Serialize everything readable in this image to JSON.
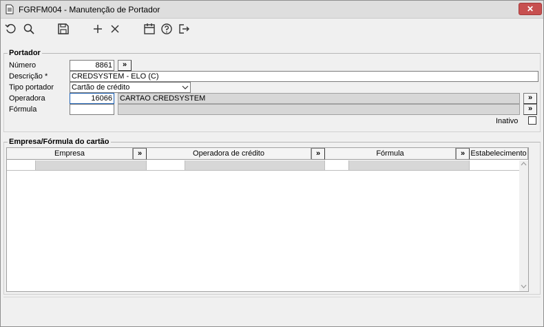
{
  "window": {
    "title": "FGRFM004 - Manutenção de Portador",
    "close_glyph": "✕"
  },
  "toolbar": {
    "buttons": [
      {
        "name": "refresh-icon"
      },
      {
        "name": "search-icon"
      },
      {
        "name": "save-icon"
      },
      {
        "name": "add-icon"
      },
      {
        "name": "delete-icon"
      },
      {
        "name": "calendar-icon"
      },
      {
        "name": "help-icon"
      },
      {
        "name": "exit-icon"
      }
    ]
  },
  "portador": {
    "title": "Portador",
    "numero_label": "Número",
    "numero_value": "8861",
    "descricao_label": "Descrição *",
    "descricao_value": "CREDSYSTEM - ELO (C)",
    "tipo_label": "Tipo portador",
    "tipo_value": "Cartão de crédito",
    "operadora_label": "Operadora",
    "operadora_code": "16066",
    "operadora_name": "CARTAO CREDSYSTEM",
    "formula_label": "Fórmula",
    "formula_code": "",
    "formula_name": "",
    "inativo_label": "Inativo",
    "inativo_checked": false,
    "lookup_glyph": "»"
  },
  "empresa_formula": {
    "title": "Empresa/Fórmula do cartão",
    "columns": [
      "Empresa",
      "Operadora de crédito",
      "Fórmula",
      "Estabelecimento"
    ],
    "rows": [],
    "lookup_glyph": "»"
  }
}
